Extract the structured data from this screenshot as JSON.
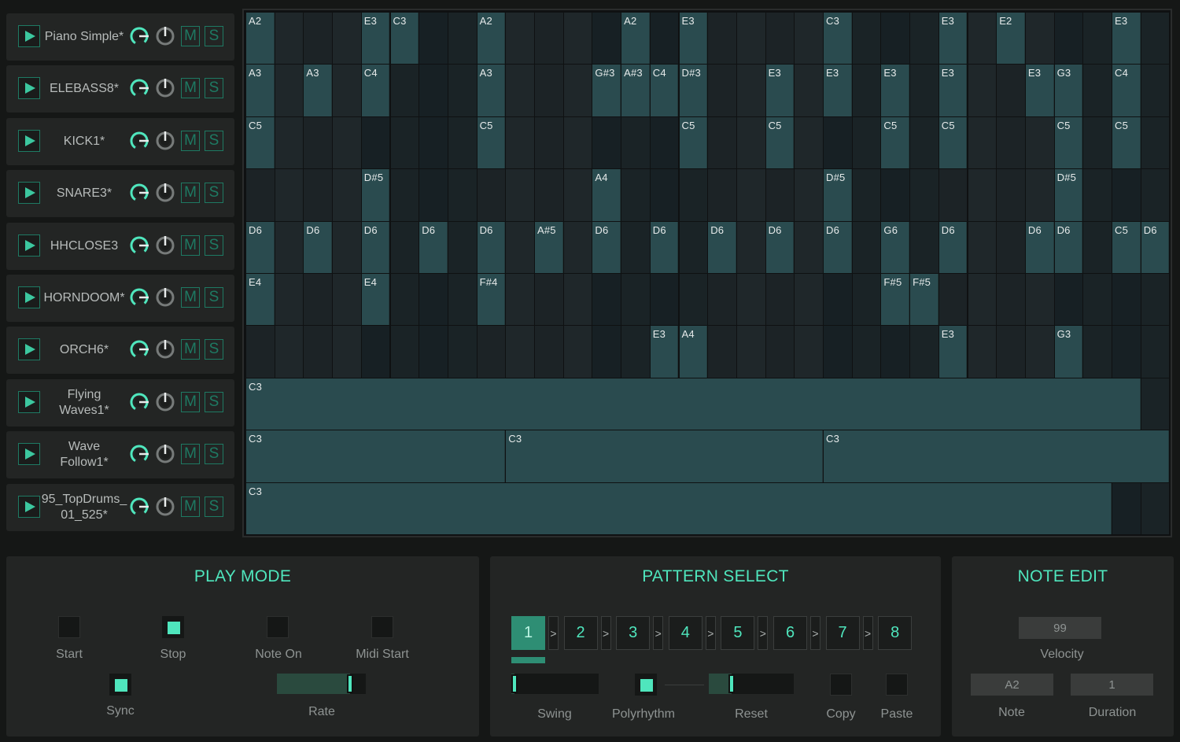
{
  "tracks": [
    {
      "name": "Piano Simple*"
    },
    {
      "name": "ELEBASS8*"
    },
    {
      "name": "KICK1*"
    },
    {
      "name": "SNARE3*"
    },
    {
      "name": "HHCLOSE3"
    },
    {
      "name": "HORNDOOM*"
    },
    {
      "name": "ORCH6*"
    },
    {
      "name": "Flying\nWaves1*"
    },
    {
      "name": "Wave Follow1*"
    },
    {
      "name": "95_TopDrums_\n01_525*"
    }
  ],
  "track_buttons": {
    "mute": "M",
    "solo": "S"
  },
  "grid": {
    "steps": 32,
    "rows": [
      {
        "notes": [
          {
            "step": 0,
            "len": 1,
            "label": "A2"
          },
          {
            "step": 4,
            "len": 1,
            "label": "E3"
          },
          {
            "step": 5,
            "len": 1,
            "label": "C3"
          },
          {
            "step": 8,
            "len": 1,
            "label": "A2"
          },
          {
            "step": 13,
            "len": 1,
            "label": "A2"
          },
          {
            "step": 15,
            "len": 1,
            "label": "E3"
          },
          {
            "step": 20,
            "len": 1,
            "label": "C3"
          },
          {
            "step": 24,
            "len": 1,
            "label": "E3"
          },
          {
            "step": 26,
            "len": 1,
            "label": "E2"
          },
          {
            "step": 30,
            "len": 1,
            "label": "E3"
          }
        ]
      },
      {
        "notes": [
          {
            "step": 0,
            "len": 1,
            "label": "A3"
          },
          {
            "step": 2,
            "len": 1,
            "label": "A3"
          },
          {
            "step": 4,
            "len": 1,
            "label": "C4"
          },
          {
            "step": 8,
            "len": 1,
            "label": "A3"
          },
          {
            "step": 12,
            "len": 1,
            "label": "G#3"
          },
          {
            "step": 13,
            "len": 1,
            "label": "A#3"
          },
          {
            "step": 14,
            "len": 1,
            "label": "C4"
          },
          {
            "step": 15,
            "len": 1,
            "label": "D#3"
          },
          {
            "step": 18,
            "len": 1,
            "label": "E3"
          },
          {
            "step": 20,
            "len": 1,
            "label": "E3"
          },
          {
            "step": 22,
            "len": 1,
            "label": "E3"
          },
          {
            "step": 24,
            "len": 1,
            "label": "E3"
          },
          {
            "step": 27,
            "len": 1,
            "label": "E3"
          },
          {
            "step": 28,
            "len": 1,
            "label": "G3"
          },
          {
            "step": 30,
            "len": 1,
            "label": "C4"
          }
        ]
      },
      {
        "notes": [
          {
            "step": 0,
            "len": 1,
            "label": "C5"
          },
          {
            "step": 8,
            "len": 1,
            "label": "C5"
          },
          {
            "step": 15,
            "len": 1,
            "label": "C5"
          },
          {
            "step": 18,
            "len": 1,
            "label": "C5"
          },
          {
            "step": 22,
            "len": 1,
            "label": "C5"
          },
          {
            "step": 24,
            "len": 1,
            "label": "C5"
          },
          {
            "step": 28,
            "len": 1,
            "label": "C5"
          },
          {
            "step": 30,
            "len": 1,
            "label": "C5"
          }
        ]
      },
      {
        "notes": [
          {
            "step": 4,
            "len": 1,
            "label": "D#5"
          },
          {
            "step": 12,
            "len": 1,
            "label": "A4"
          },
          {
            "step": 20,
            "len": 1,
            "label": "D#5"
          },
          {
            "step": 28,
            "len": 1,
            "label": "D#5"
          }
        ]
      },
      {
        "notes": [
          {
            "step": 0,
            "len": 1,
            "label": "D6"
          },
          {
            "step": 2,
            "len": 1,
            "label": "D6"
          },
          {
            "step": 4,
            "len": 1,
            "label": "D6"
          },
          {
            "step": 6,
            "len": 1,
            "label": "D6"
          },
          {
            "step": 8,
            "len": 1,
            "label": "D6"
          },
          {
            "step": 10,
            "len": 1,
            "label": "A#5"
          },
          {
            "step": 12,
            "len": 1,
            "label": "D6"
          },
          {
            "step": 14,
            "len": 1,
            "label": "D6"
          },
          {
            "step": 16,
            "len": 1,
            "label": "D6"
          },
          {
            "step": 18,
            "len": 1,
            "label": "D6"
          },
          {
            "step": 20,
            "len": 1,
            "label": "D6"
          },
          {
            "step": 22,
            "len": 1,
            "label": "G6"
          },
          {
            "step": 24,
            "len": 1,
            "label": "D6"
          },
          {
            "step": 27,
            "len": 1,
            "label": "D6"
          },
          {
            "step": 28,
            "len": 1,
            "label": "D6"
          },
          {
            "step": 30,
            "len": 1,
            "label": "C5"
          },
          {
            "step": 31,
            "len": 1,
            "label": "D6"
          }
        ]
      },
      {
        "notes": [
          {
            "step": 0,
            "len": 1,
            "label": "E4"
          },
          {
            "step": 4,
            "len": 1,
            "label": "E4"
          },
          {
            "step": 8,
            "len": 1,
            "label": "F#4"
          },
          {
            "step": 22,
            "len": 1,
            "label": "F#5"
          },
          {
            "step": 23,
            "len": 1,
            "label": "F#5"
          }
        ]
      },
      {
        "notes": [
          {
            "step": 14,
            "len": 1,
            "label": "E3"
          },
          {
            "step": 15,
            "len": 1,
            "label": "A4"
          },
          {
            "step": 24,
            "len": 1,
            "label": "E3"
          },
          {
            "step": 28,
            "len": 1,
            "label": "G3"
          }
        ]
      },
      {
        "notes": [
          {
            "step": 0,
            "len": 31,
            "label": "C3"
          }
        ]
      },
      {
        "notes": [
          {
            "step": 0,
            "len": 9,
            "label": "C3"
          },
          {
            "step": 9,
            "len": 11,
            "label": "C3"
          },
          {
            "step": 20,
            "len": 12,
            "label": "C3"
          }
        ]
      },
      {
        "notes": [
          {
            "step": 0,
            "len": 30,
            "label": "C3"
          }
        ]
      }
    ]
  },
  "play_mode": {
    "title": "PLAY MODE",
    "start": {
      "label": "Start",
      "checked": false
    },
    "stop": {
      "label": "Stop",
      "checked": true
    },
    "note_on": {
      "label": "Note On",
      "checked": false
    },
    "midi_start": {
      "label": "Midi Start",
      "checked": false
    },
    "sync": {
      "label": "Sync",
      "checked": true
    },
    "rate": {
      "label": "Rate",
      "value": 0.85
    }
  },
  "pattern_select": {
    "title": "PATTERN SELECT",
    "patterns": [
      "1",
      "2",
      "3",
      "4",
      "5",
      "6",
      "7",
      "8"
    ],
    "selected": 0,
    "arrow": ">",
    "swing": {
      "label": "Swing",
      "value": 0.0
    },
    "polyrhythm": {
      "label": "Polyrhythm",
      "checked": true
    },
    "reset": {
      "label": "Reset",
      "value": 0.25
    },
    "copy": {
      "label": "Copy"
    },
    "paste": {
      "label": "Paste"
    }
  },
  "note_edit": {
    "title": "NOTE EDIT",
    "velocity": {
      "label": "Velocity",
      "value": "99"
    },
    "note": {
      "label": "Note",
      "value": "A2"
    },
    "duration": {
      "label": "Duration",
      "value": "1"
    }
  },
  "colors": {
    "accent": "#4fe6bd",
    "note_fill": "#2a4b4f",
    "grid_bg": "#0f1112"
  }
}
